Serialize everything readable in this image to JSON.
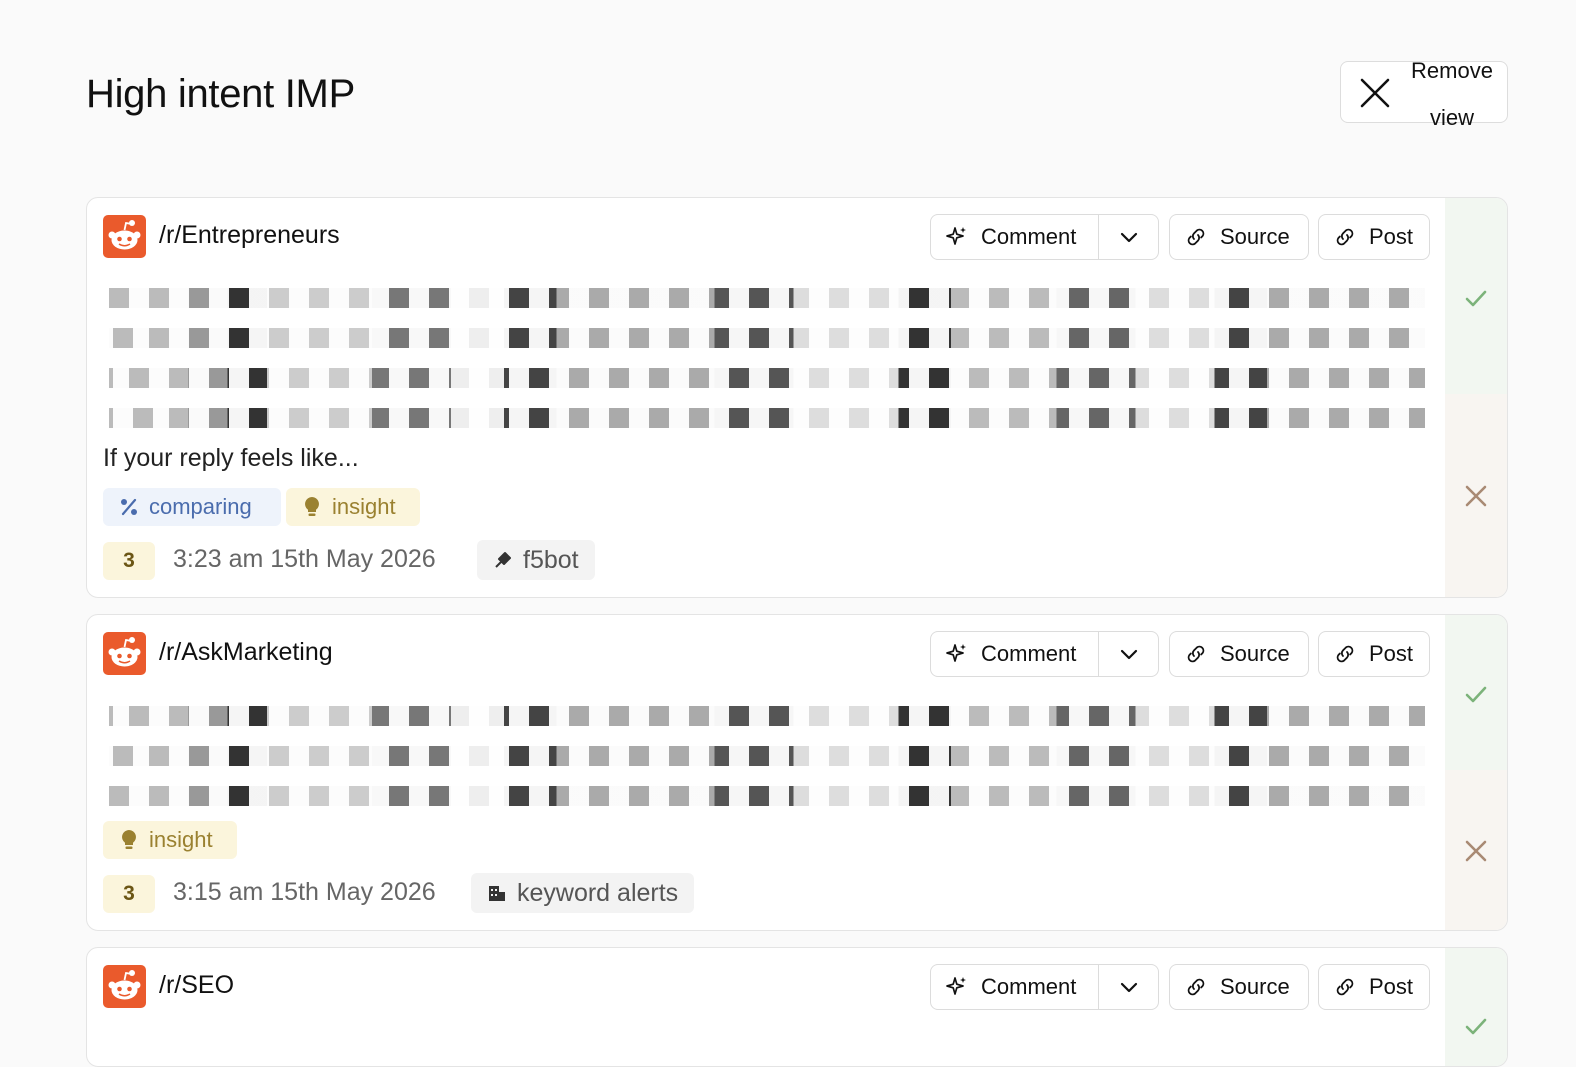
{
  "page": {
    "title": "High intent IMP",
    "remove_line1": "Remove",
    "remove_line2": "view"
  },
  "buttons": {
    "comment": "Comment",
    "source": "Source",
    "post": "Post"
  },
  "cards": [
    {
      "subreddit": "/r/Entrepreneurs",
      "body_tail": "If your reply feels like...",
      "tags": [
        "comparing",
        "insight"
      ],
      "score": "3",
      "timestamp": "3:23 am 15th May 2026",
      "source": "f5bot"
    },
    {
      "subreddit": "/r/AskMarketing",
      "tags": [
        "insight"
      ],
      "score": "3",
      "timestamp": "3:15 am 15th May 2026",
      "source": "keyword alerts"
    },
    {
      "subreddit": "/r/SEO"
    }
  ],
  "colors": {
    "reddit_orange": "#ea5a2c",
    "approve_green": "#7cb37a",
    "reject_brown": "#a98a74",
    "insight_bg": "#fbf5dc",
    "comparing_bg": "#eef3fb"
  }
}
